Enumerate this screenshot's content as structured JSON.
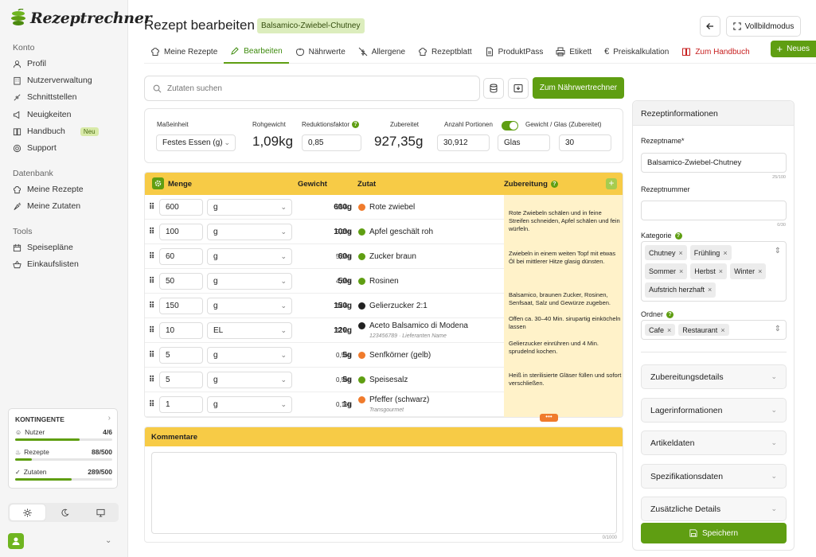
{
  "app": {
    "name": "Rezeptrechner"
  },
  "sidebar": {
    "sections": [
      {
        "title": "Konto",
        "items": [
          {
            "label": "Profil",
            "icon": "user-icon"
          },
          {
            "label": "Nutzerverwaltung",
            "icon": "building-icon"
          },
          {
            "label": "Schnittstellen",
            "icon": "plug-icon"
          },
          {
            "label": "Neuigkeiten",
            "icon": "megaphone-icon"
          },
          {
            "label": "Handbuch",
            "icon": "book-icon",
            "badge": "Neu"
          },
          {
            "label": "Support",
            "icon": "lifebuoy-icon"
          }
        ]
      },
      {
        "title": "Datenbank",
        "items": [
          {
            "label": "Meine Rezepte",
            "icon": "chef-hat-icon"
          },
          {
            "label": "Meine Zutaten",
            "icon": "carrot-icon"
          }
        ]
      },
      {
        "title": "Tools",
        "items": [
          {
            "label": "Speisepläne",
            "icon": "calendar-icon"
          },
          {
            "label": "Einkaufslisten",
            "icon": "basket-icon"
          }
        ]
      }
    ],
    "kontingente": {
      "title": "KONTINGENTE",
      "rows": [
        {
          "label": "Nutzer",
          "value": "4/6",
          "fill": 0.667
        },
        {
          "label": "Rezepte",
          "value": "88/500",
          "fill": 0.176
        },
        {
          "label": "Zutaten",
          "value": "289/500",
          "fill": 0.578
        }
      ]
    }
  },
  "header": {
    "title": "Rezept bearbeiten",
    "badge": "Balsamico-Zwiebel-Chutney",
    "fullscreen": "Vollbildmodus",
    "new_button": "Neues"
  },
  "tabs": [
    {
      "label": "Meine Rezepte",
      "icon": "chef-hat-icon"
    },
    {
      "label": "Bearbeiten",
      "icon": "pencil-icon",
      "active": true
    },
    {
      "label": "Nährwerte",
      "icon": "apple-icon"
    },
    {
      "label": "Allergene",
      "icon": "wheat-off-icon"
    },
    {
      "label": "Rezeptblatt",
      "icon": "chef-hat-icon"
    },
    {
      "label": "ProduktPass",
      "icon": "document-icon"
    },
    {
      "label": "Etikett",
      "icon": "printer-icon"
    },
    {
      "label": "Preiskalkulation",
      "icon": "euro-icon"
    },
    {
      "label": "Zum Handbuch",
      "icon": "book-icon",
      "red": true
    }
  ],
  "search": {
    "placeholder": "Zutaten suchen",
    "calculator_button": "Zum Nährwertrechner"
  },
  "meta": {
    "masseinheit_label": "Maßeinheit",
    "masseinheit_value": "Festes Essen (g)",
    "rohgewicht_label": "Rohgewicht",
    "rohgewicht_value": "1,09kg",
    "reduktion_label": "Reduktionsfaktor",
    "reduktion_value": "0,85",
    "zubereitet_label": "Zubereitet",
    "zubereitet_value": "927,35g",
    "portionen_label": "Anzahl Portionen",
    "portionen_value": "30,912",
    "gewicht_label": "Gewicht / Glas (Zubereitet)",
    "gewicht_unit": "Glas",
    "gewicht_value": "30"
  },
  "table": {
    "headers": {
      "menge": "Menge",
      "gewicht": "Gewicht",
      "zutat": "Zutat",
      "zubereitung": "Zubereitung"
    },
    "rows": [
      {
        "qty": "600",
        "unit": "g",
        "weight": "600g",
        "pct": "55%",
        "name": "Rote zwiebel",
        "sub": "",
        "color": "#f07b2c"
      },
      {
        "qty": "100",
        "unit": "g",
        "weight": "100g",
        "pct": "9,2%",
        "name": "Apfel geschält roh",
        "sub": "",
        "color": "#5f9e12"
      },
      {
        "qty": "60",
        "unit": "g",
        "weight": "60g",
        "pct": "5,5%",
        "name": "Zucker braun",
        "sub": "",
        "color": "#5f9e12"
      },
      {
        "qty": "50",
        "unit": "g",
        "weight": "50g",
        "pct": "4,6%",
        "name": "Rosinen",
        "sub": "",
        "color": "#5f9e12"
      },
      {
        "qty": "150",
        "unit": "g",
        "weight": "150g",
        "pct": "14%",
        "name": "Gelierzucker 2:1",
        "sub": "",
        "color": "#222222"
      },
      {
        "qty": "10",
        "unit": "EL",
        "weight": "120g",
        "pct": "11%",
        "name": "Aceto Balsamico di Modena",
        "sub": "123456789 · Lieferanten Name",
        "color": "#222222"
      },
      {
        "qty": "5",
        "unit": "g",
        "weight": "5g",
        "pct": "0,5%",
        "name": "Senfkörner (gelb)",
        "sub": "",
        "color": "#f07b2c"
      },
      {
        "qty": "5",
        "unit": "g",
        "weight": "5g",
        "pct": "0,5%",
        "name": "Speisesalz",
        "sub": "",
        "color": "#5f9e12"
      },
      {
        "qty": "1",
        "unit": "g",
        "weight": "1g",
        "pct": "0,1%",
        "name": "Pfeffer (schwarz)",
        "sub": "Transgourmet",
        "color": "#f07b2c"
      }
    ],
    "steps": [
      "Rote Zwiebeln schälen und in feine Streifen schneiden, Apfel schälen und fein würfeln.",
      "Zwiebeln in einem weiten Topf mit etwas Öl bei mittlerer Hitze glasig dünsten.",
      "Balsamico, braunen Zucker, Rosinen, Senfsaat, Salz und Gewürze zugeben.",
      "Offen ca. 30–40 Min. sirupartig einköcheln lassen",
      "Gelierzucker einrühren und 4 Min. sprudelnd kochen.",
      "Heiß in sterilisierte Gläser füllen und sofort verschließen."
    ],
    "more_label": "•••"
  },
  "kommentare": {
    "title": "Kommentare",
    "count": "0/1000"
  },
  "panel": {
    "title": "Rezeptinformationen",
    "name_label": "Rezeptname*",
    "name_value": "Balsamico-Zwiebel-Chutney",
    "name_count": "25/100",
    "number_label": "Rezeptnummer",
    "number_value": "",
    "number_count": "0/30",
    "kategorie_label": "Kategorie",
    "kategorien": [
      "Chutney",
      "Frühling",
      "Sommer",
      "Herbst",
      "Winter",
      "Aufstrich herzhaft"
    ],
    "ordner_label": "Ordner",
    "ordner": [
      "Cafe",
      "Restaurant"
    ],
    "sections": [
      "Zubereitungsdetails",
      "Lagerinformationen",
      "Artikeldaten",
      "Spezifikationsdaten",
      "Zusätzliche Details"
    ],
    "save_label": "Speichern"
  }
}
